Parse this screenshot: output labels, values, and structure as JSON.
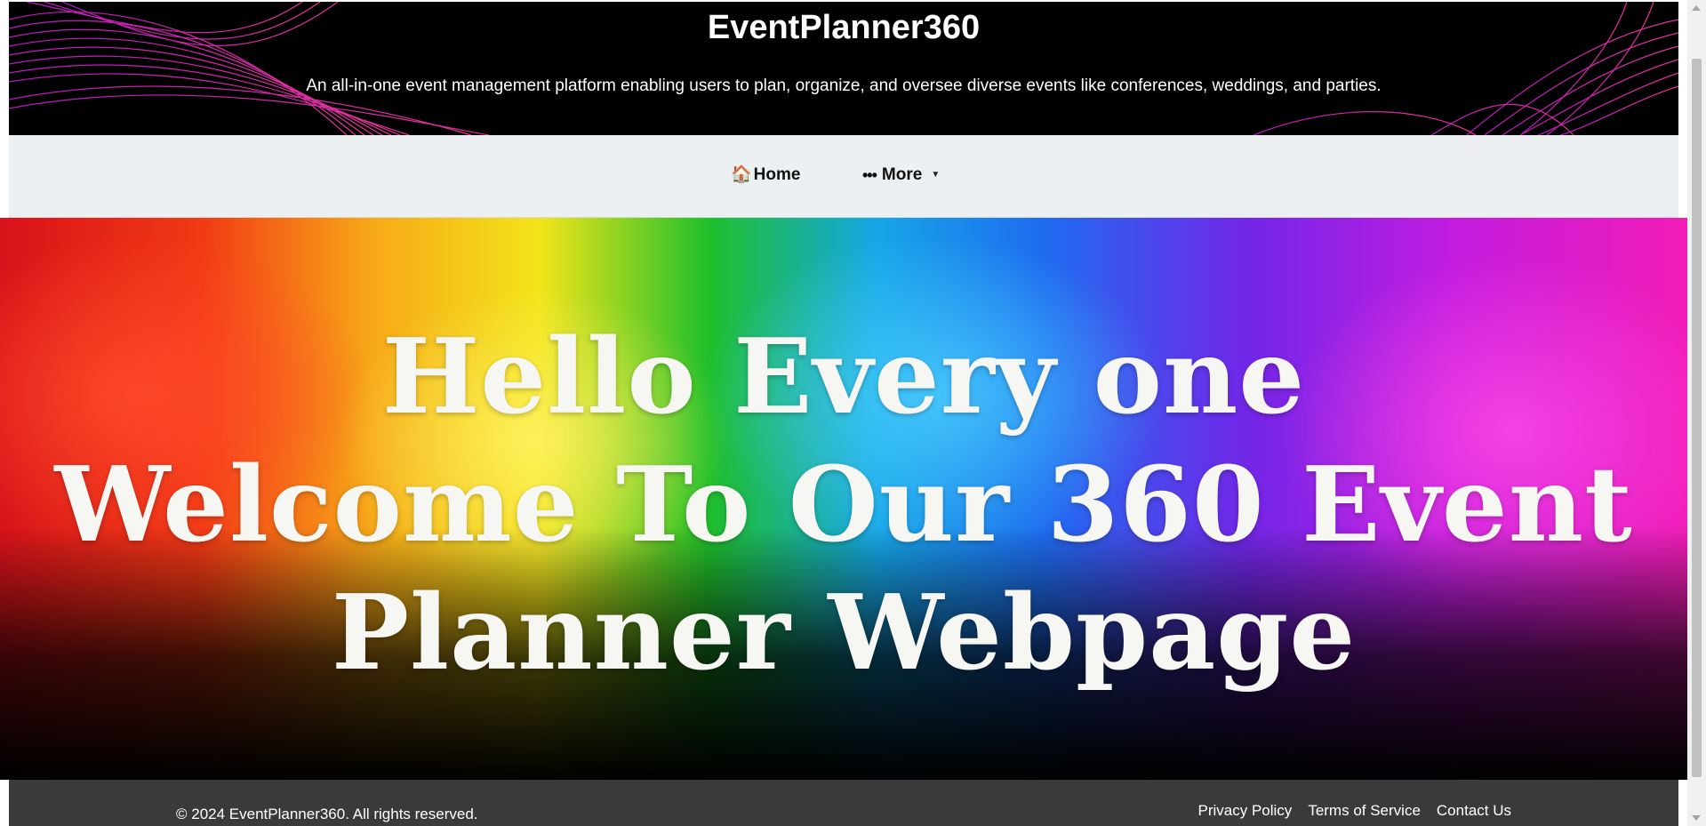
{
  "header": {
    "title": "EventPlanner360",
    "tagline": "An all-in-one event management platform enabling users to plan, organize, and oversee diverse events like conferences, weddings, and parties."
  },
  "nav": {
    "home_icon": "house-icon",
    "home_label": "Home",
    "more_icon": "dots-icon",
    "more_label": "More",
    "more_caret": "chevron-down-icon"
  },
  "hero": {
    "line1": "Hello Every one",
    "line2": "Welcome To Our 360 Event",
    "line3": "Planner Webpage"
  },
  "footer": {
    "copyright": "© 2024 EventPlanner360. All rights reserved.",
    "links": [
      "Privacy Policy",
      "Terms of Service",
      "Contact Us"
    ]
  },
  "colors": {
    "header_bg": "#000000",
    "wave_accent": "#e21fd6",
    "nav_bg": "#edf0f2",
    "footer_bg": "#3a3a3a",
    "hero_text": "#f6f6f2"
  }
}
